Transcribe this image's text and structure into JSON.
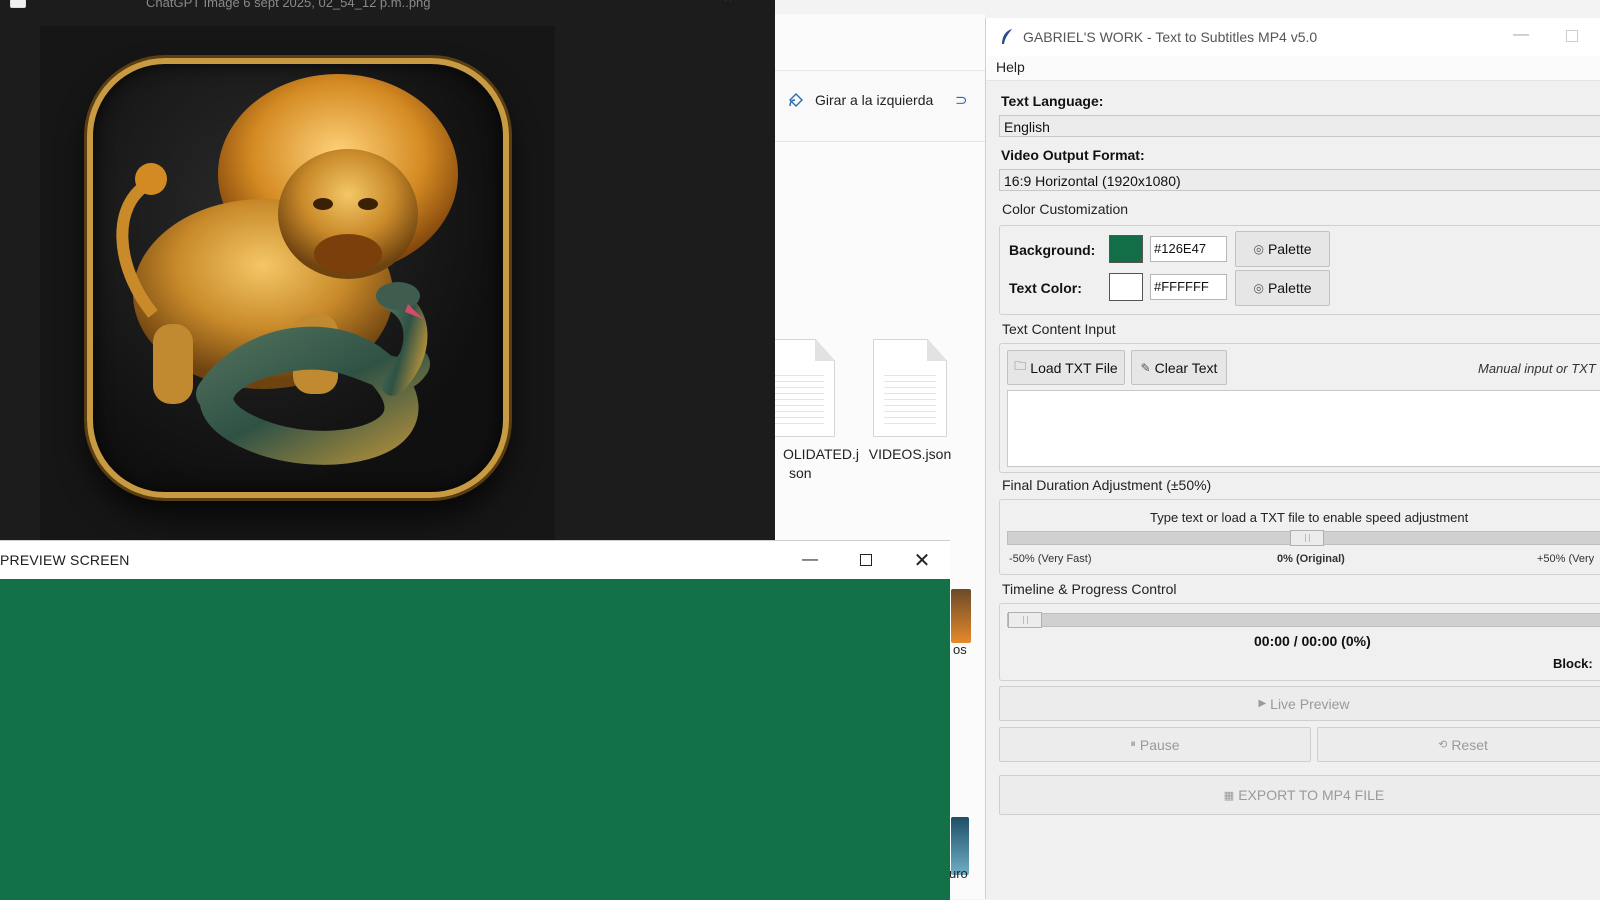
{
  "viewer": {
    "title": "ChatGPT Image 6 sept 2025, 02_54_12 p.m..png"
  },
  "explorer": {
    "rotate_label": "Girar a la izquierda",
    "files": [
      {
        "name": "OLIDATED.j",
        "name2": "son"
      },
      {
        "name": "VIDEOS.json",
        "name2": ""
      }
    ],
    "partial_labels": [
      "os",
      "uro"
    ]
  },
  "preview": {
    "title": "PREVIEW SCREEN",
    "background": "#126E47"
  },
  "app": {
    "title": "GABRIEL'S WORK - Text to Subtitles MP4 v5.0",
    "menu_help": "Help",
    "text_language_label": "Text Language:",
    "text_language_value": "English",
    "video_format_label": "Video Output Format:",
    "video_format_value": "16:9 Horizontal (1920x1080)",
    "color_group_title": "Color Customization",
    "background_label": "Background:",
    "background_hex": "#126E47",
    "text_color_label": "Text Color:",
    "text_color_hex": "#FFFFFF",
    "palette_label": "Palette",
    "text_input_title": "Text Content Input",
    "load_txt_label": "Load TXT File",
    "clear_text_label": "Clear Text",
    "manual_hint": "Manual input or TXT",
    "duration_title": "Final Duration Adjustment (±50%)",
    "duration_hint": "Type text or load a TXT file to enable speed adjustment",
    "speed_min_label": "-50% (Very Fast)",
    "speed_mid_label": "0% (Original)",
    "speed_max_label": "+50% (Very",
    "speed_value": 0.5,
    "timeline_title": "Timeline & Progress Control",
    "time_readout": "00:00 / 00:00 (0%)",
    "block_label": "Block:",
    "live_preview_label": "Live Preview",
    "pause_label": "Pause",
    "reset_label": "Reset",
    "export_label": "EXPORT TO MP4 FILE"
  }
}
